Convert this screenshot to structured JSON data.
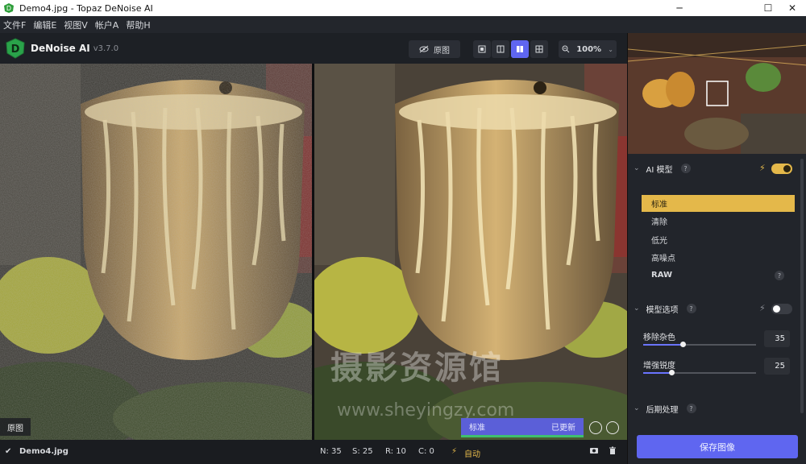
{
  "window": {
    "title": "Demo4.jpg - Topaz DeNoise AI",
    "minimize": "─",
    "maximize": "☐",
    "close": "✕"
  },
  "menu": [
    "文件F",
    "编辑E",
    "视图V",
    "帐户A",
    "帮助H"
  ],
  "app": {
    "name": "DeNoise AI",
    "version": "v3.7.0",
    "logo_letter": "D"
  },
  "toolbar": {
    "original_label": "原图",
    "zoom": "100%"
  },
  "viewer": {
    "left_tag": "原图",
    "status_model": "标准",
    "status_state": "已更新",
    "watermark_cn": "摄影资源馆",
    "watermark_url": "www.sheyingzy.com"
  },
  "statusbar": {
    "filename": "Demo4.jpg",
    "n": "N: 35",
    "s": "S: 25",
    "r": "R: 10",
    "c": "C: 0",
    "auto": "自动"
  },
  "panel": {
    "ai_model": {
      "title": "AI 模型",
      "help": "?",
      "enabled": true,
      "models": [
        "标准",
        "清除",
        "低光",
        "高噪点",
        "RAW"
      ],
      "selected": "标准",
      "raw_help": "?"
    },
    "model_options": {
      "title": "模型选项",
      "help": "?",
      "enabled": false,
      "remove_noise": {
        "label": "移除杂色",
        "value": "35",
        "level": 0.35
      },
      "enhance_sharpness": {
        "label": "增强锐度",
        "value": "25",
        "level": 0.25
      }
    },
    "post": {
      "title": "后期处理",
      "help": "?"
    },
    "save_label": "保存图像"
  },
  "colors": {
    "accent": "#e4b84a",
    "primary": "#5f66f0",
    "bg": "#1b1d22"
  }
}
